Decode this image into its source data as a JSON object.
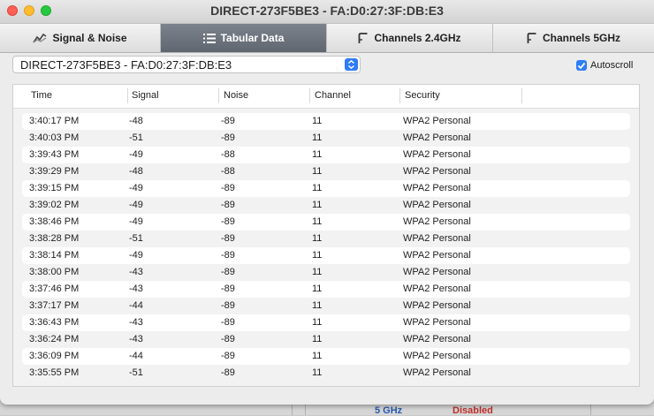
{
  "window": {
    "title": "DIRECT-273F5BE3 - FA:D0:27:3F:DB:E3"
  },
  "tabs": [
    {
      "label": "Signal & Noise",
      "icon": "chart-line-icon",
      "active": false
    },
    {
      "label": "Tabular Data",
      "icon": "list-icon",
      "active": true
    },
    {
      "label": "Channels 2.4GHz",
      "icon": "channel-icon",
      "active": false
    },
    {
      "label": "Channels 5GHz",
      "icon": "channel-icon",
      "active": false
    }
  ],
  "network_select": {
    "value": "DIRECT-273F5BE3 - FA:D0:27:3F:DB:E3"
  },
  "autoscroll": {
    "label": "Autoscroll",
    "checked": true
  },
  "table": {
    "columns": [
      "Time",
      "Signal",
      "Noise",
      "Channel",
      "Security"
    ],
    "rows": [
      [
        "3:40:17 PM",
        "-48",
        "-89",
        "11",
        "WPA2 Personal"
      ],
      [
        "3:40:03 PM",
        "-51",
        "-89",
        "11",
        "WPA2 Personal"
      ],
      [
        "3:39:43 PM",
        "-49",
        "-88",
        "11",
        "WPA2 Personal"
      ],
      [
        "3:39:29 PM",
        "-48",
        "-88",
        "11",
        "WPA2 Personal"
      ],
      [
        "3:39:15 PM",
        "-49",
        "-89",
        "11",
        "WPA2 Personal"
      ],
      [
        "3:39:02 PM",
        "-49",
        "-89",
        "11",
        "WPA2 Personal"
      ],
      [
        "3:38:46 PM",
        "-49",
        "-89",
        "11",
        "WPA2 Personal"
      ],
      [
        "3:38:28 PM",
        "-51",
        "-89",
        "11",
        "WPA2 Personal"
      ],
      [
        "3:38:14 PM",
        "-49",
        "-89",
        "11",
        "WPA2 Personal"
      ],
      [
        "3:38:00 PM",
        "-43",
        "-89",
        "11",
        "WPA2 Personal"
      ],
      [
        "3:37:46 PM",
        "-43",
        "-89",
        "11",
        "WPA2 Personal"
      ],
      [
        "3:37:17 PM",
        "-44",
        "-89",
        "11",
        "WPA2 Personal"
      ],
      [
        "3:36:43 PM",
        "-43",
        "-89",
        "11",
        "WPA2 Personal"
      ],
      [
        "3:36:24 PM",
        "-43",
        "-89",
        "11",
        "WPA2 Personal"
      ],
      [
        "3:36:09 PM",
        "-44",
        "-89",
        "11",
        "WPA2 Personal"
      ],
      [
        "3:35:55 PM",
        "-51",
        "-89",
        "11",
        "WPA2 Personal"
      ]
    ]
  },
  "background_app": {
    "band_label": "5 GHz",
    "status_label": "Disabled"
  },
  "colors": {
    "accent": "#2f7cf6",
    "close": "#fe5f57",
    "minimize": "#febc2e",
    "maximize": "#28c840"
  }
}
